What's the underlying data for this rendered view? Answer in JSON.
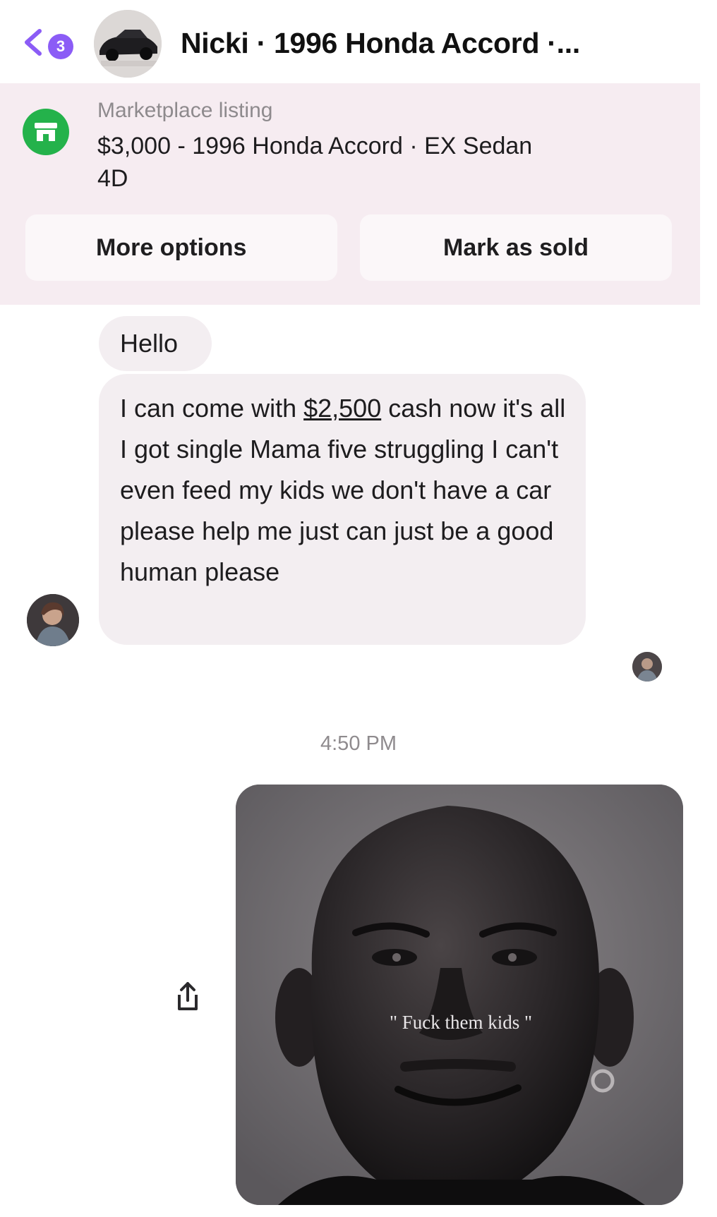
{
  "header": {
    "back_badge": "3",
    "title": "Nicki · 1996 Honda Accord ·..."
  },
  "listing": {
    "label": "Marketplace listing",
    "title": "$3,000 - 1996 Honda Accord · EX Sedan 4D",
    "more_options_label": "More options",
    "mark_sold_label": "Mark as sold"
  },
  "messages": {
    "hello": "Hello",
    "long_prefix": "I can come with ",
    "long_price": "$2,500",
    "long_suffix": " cash now it's all I got single Mama five struggling I can't even feed my kids we don't have a car please help me just can just be a good human please"
  },
  "timestamp": "4:50 PM",
  "meme": {
    "caption": "\" Fuck them kids \""
  },
  "colors": {
    "accent": "#8b5cf6",
    "listing_bg": "#f6ecf1",
    "marketplace_green": "#24b24b"
  }
}
